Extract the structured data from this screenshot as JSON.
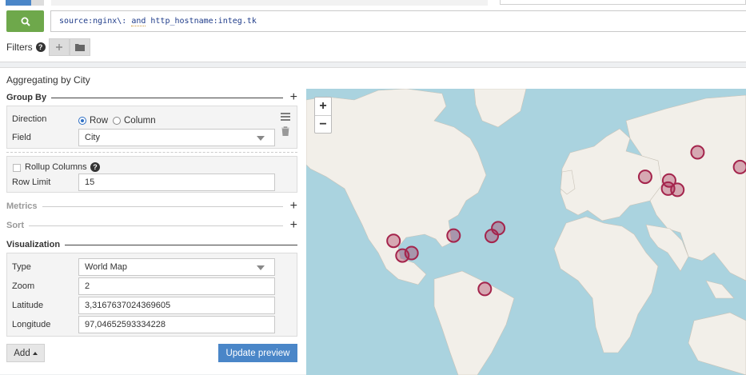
{
  "query": {
    "prefix": "source:nginx\\: ",
    "keyword": "and",
    "suffix": " http_hostname:integ.tk"
  },
  "filters": {
    "label": "Filters",
    "help": "?"
  },
  "panel": {
    "title": "Aggregating by City"
  },
  "group_by": {
    "label": "Group By",
    "direction_label": "Direction",
    "row_option": "Row",
    "column_option": "Column",
    "selected": "Row",
    "field_label": "Field",
    "field_value": "City",
    "rollup_label": "Rollup Columns",
    "rollup_help": "?",
    "row_limit_label": "Row Limit",
    "row_limit_value": "15"
  },
  "metrics": {
    "label": "Metrics"
  },
  "sort": {
    "label": "Sort"
  },
  "visualization": {
    "label": "Visualization",
    "type_label": "Type",
    "type_value": "World Map",
    "zoom_label": "Zoom",
    "zoom_value": "2",
    "latitude_label": "Latitude",
    "latitude_value": "3,3167637024369605",
    "longitude_label": "Longitude",
    "longitude_value": "97,04652593334228"
  },
  "buttons": {
    "add": "Add",
    "update_preview": "Update preview"
  },
  "map": {
    "zoom_in": "+",
    "zoom_out": "−",
    "marker_color": "#a4244c",
    "water_color": "#aad3df",
    "land_color": "#f2efe9",
    "markers": [
      {
        "city_lat": 37.6,
        "city_lon": -122.3
      },
      {
        "city_lat": 34.0,
        "city_lon": -118.2
      },
      {
        "city_lat": 34.6,
        "city_lon": -114.0
      },
      {
        "city_lat": 38.9,
        "city_lon": -94.6
      },
      {
        "city_lat": 40.7,
        "city_lon": -74.0
      },
      {
        "city_lat": 38.8,
        "city_lon": -77.0
      },
      {
        "city_lat": 25.8,
        "city_lon": -80.2
      },
      {
        "city_lat": 53.3,
        "city_lon": -6.2
      },
      {
        "city_lat": 50.1,
        "city_lon": 8.7
      },
      {
        "city_lat": 50.4,
        "city_lon": 4.4
      },
      {
        "city_lat": 52.4,
        "city_lon": 4.9
      },
      {
        "city_lat": 59.3,
        "city_lon": 18.0
      },
      {
        "city_lat": 55.7,
        "city_lon": 37.6
      }
    ]
  }
}
